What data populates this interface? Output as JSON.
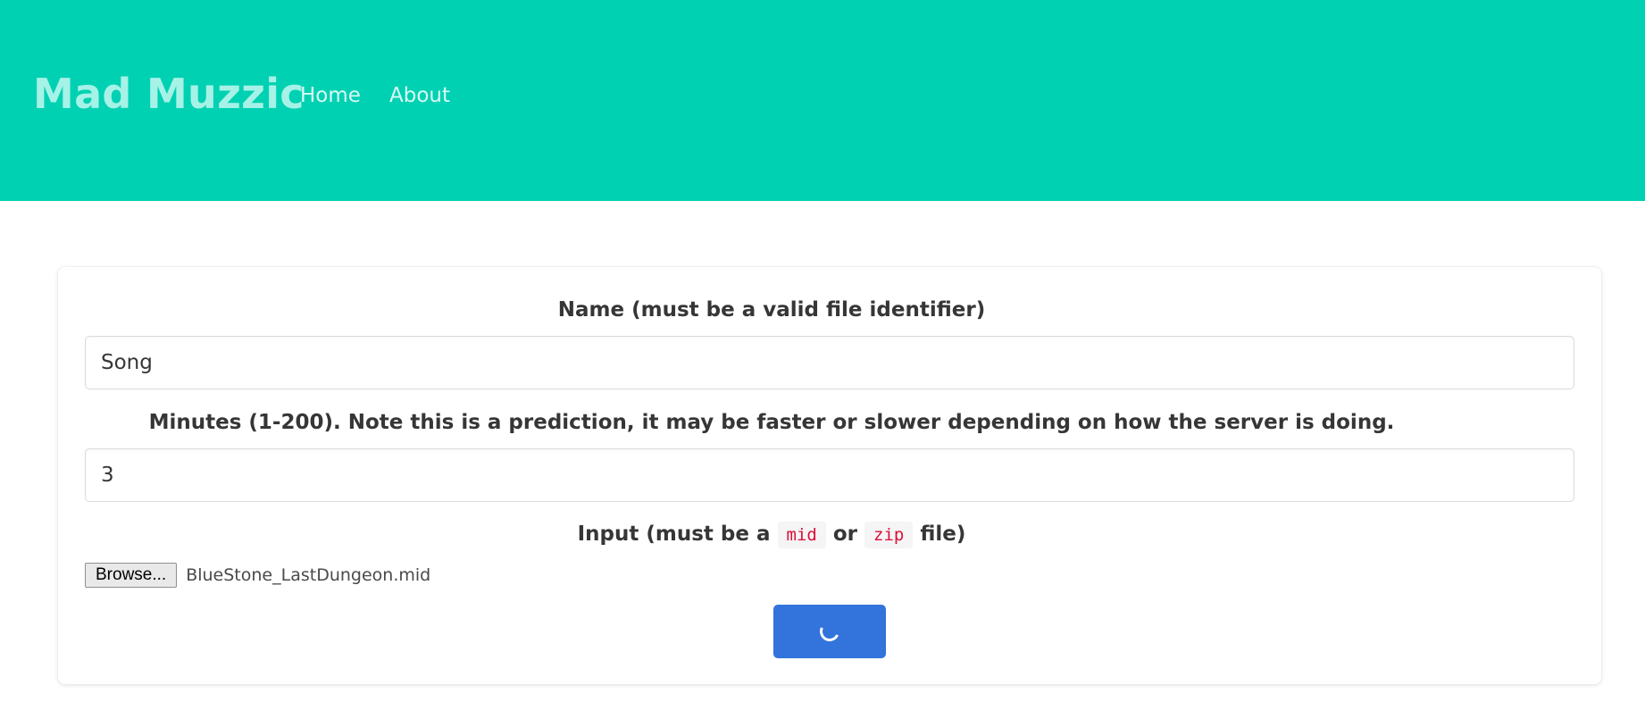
{
  "header": {
    "brand": "Mad Muzzic",
    "nav": [
      {
        "label": "Home"
      },
      {
        "label": "About"
      }
    ]
  },
  "form": {
    "name_label": "Name (must be a valid file identifier)",
    "name_value": "Song",
    "minutes_label": "Minutes (1-200). Note this is a prediction, it may be faster or slower depending on how the server is doing.",
    "minutes_value": "3",
    "input_label_prefix": "Input (must be a ",
    "input_label_code1": "mid",
    "input_label_middle": " or ",
    "input_label_code2": "zip",
    "input_label_suffix": " file)",
    "browse_label": "Browse...",
    "file_name": "BlueStone_LastDungeon.mid",
    "submit_state": "loading"
  },
  "colors": {
    "hero": "#00d1b2",
    "primary_button": "#3273dc",
    "code_text": "#da1039"
  },
  "icons": {
    "submit": "loading-spinner-icon"
  }
}
